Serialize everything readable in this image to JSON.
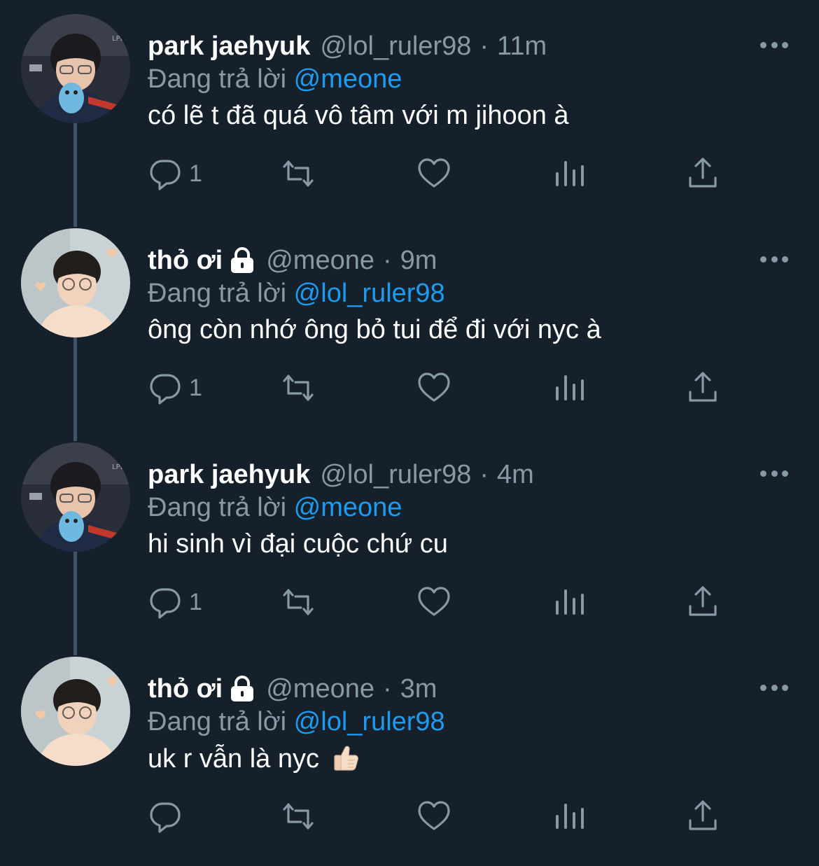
{
  "colors": {
    "background": "#15202b",
    "text": "#ffffff",
    "secondary": "#8899a6",
    "mention": "#1d9bf0",
    "thread_line": "#3d5466"
  },
  "reply_prefix": "Đang trả lời",
  "tweets": [
    {
      "name": "park jaehyuk",
      "locked": false,
      "handle": "@lol_ruler98",
      "sep": "·",
      "time": "11m",
      "reply_to": "@meone",
      "text": "có lẽ t đã quá vô tâm với m jihoon à",
      "reply_count": "1",
      "avatar": "avatar-jaehyuk"
    },
    {
      "name": "thỏ ơi",
      "locked": true,
      "handle": "@meone",
      "sep": "·",
      "time": "9m",
      "reply_to": "@lol_ruler98",
      "text": "ông còn nhớ ông bỏ tui để đi với nyc à",
      "reply_count": "1",
      "avatar": "avatar-meone"
    },
    {
      "name": "park jaehyuk",
      "locked": false,
      "handle": "@lol_ruler98",
      "sep": "·",
      "time": "4m",
      "reply_to": "@meone",
      "text": "hi sinh vì đại cuộc chứ cu",
      "reply_count": "1",
      "avatar": "avatar-jaehyuk"
    },
    {
      "name": "thỏ ơi",
      "locked": true,
      "handle": "@meone",
      "sep": "·",
      "time": "3m",
      "reply_to": "@lol_ruler98",
      "text": "uk r vẫn là nyc",
      "emoji": "thumbs-up-emoji",
      "reply_count": "",
      "avatar": "avatar-meone"
    }
  ],
  "icons": {
    "reply": "reply-icon",
    "retweet": "retweet-icon",
    "like": "heart-icon",
    "views": "views-icon",
    "share": "share-icon",
    "more": "more-icon",
    "lock": "lock-icon"
  }
}
